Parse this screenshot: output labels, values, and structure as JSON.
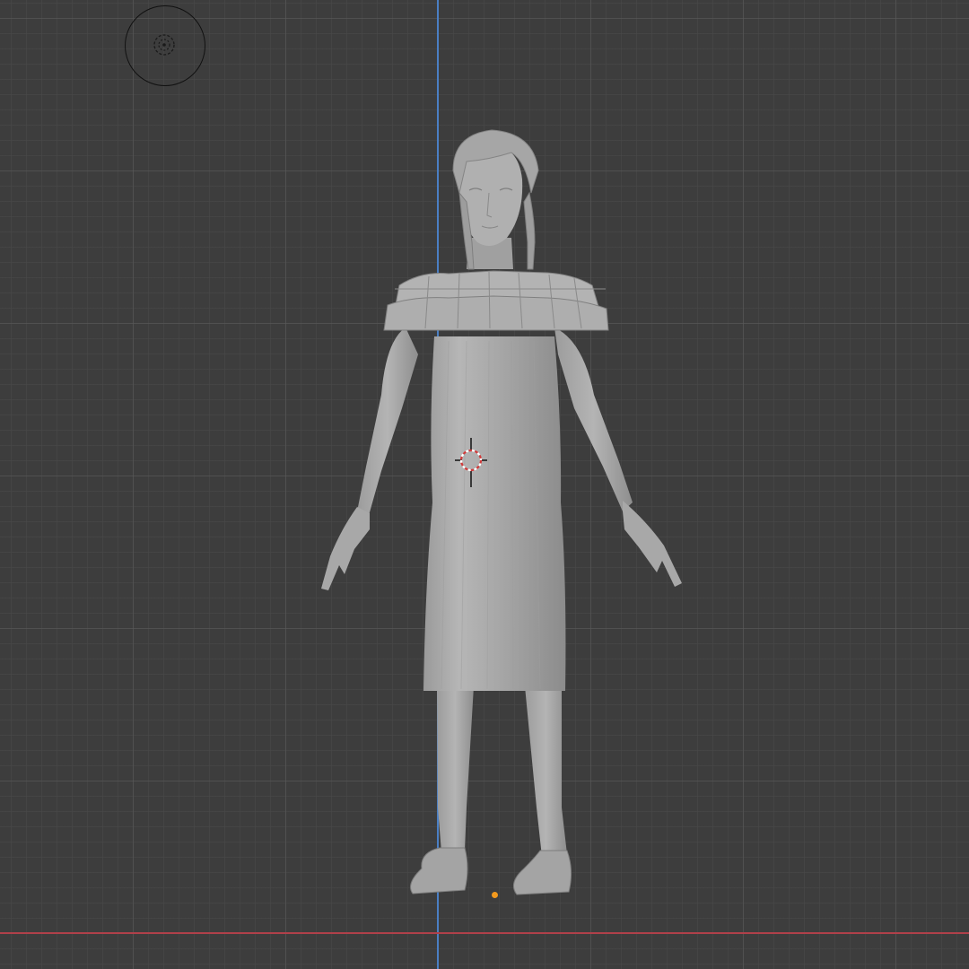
{
  "viewport": {
    "background_color": "#3d3d3d",
    "grid_color": "#5a5a5a",
    "axis_z_color": "#4a7fc4",
    "axis_x_color": "#b0404a",
    "origin_color": "#f39a1e"
  },
  "icons": {
    "navigation_gizmo": "view-navigation-icon",
    "cursor": "3d-cursor-icon",
    "origin": "object-origin-icon"
  },
  "model": {
    "shading": "solid",
    "mesh_color": "#a9a9a9"
  }
}
